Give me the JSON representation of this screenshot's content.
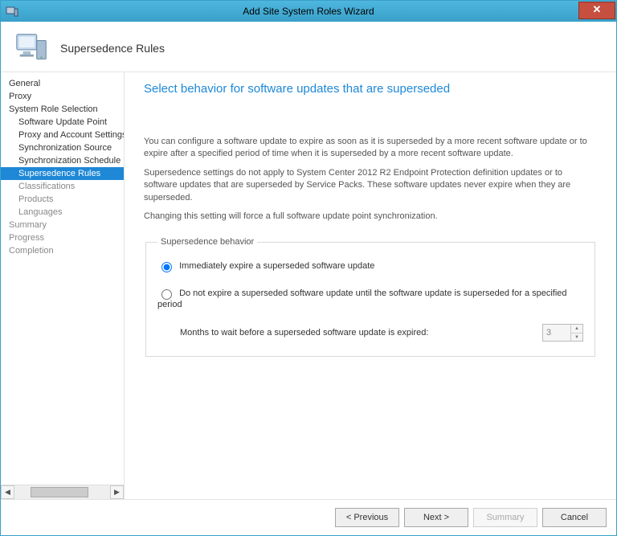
{
  "window": {
    "title": "Add Site System Roles Wizard"
  },
  "header": {
    "page_label": "Supersedence Rules"
  },
  "nav": {
    "items": [
      {
        "label": "General",
        "level": 0,
        "state": "past"
      },
      {
        "label": "Proxy",
        "level": 0,
        "state": "past"
      },
      {
        "label": "System Role Selection",
        "level": 0,
        "state": "past"
      },
      {
        "label": "Software Update Point",
        "level": 1,
        "state": "past"
      },
      {
        "label": "Proxy and Account Settings",
        "level": 1,
        "state": "past"
      },
      {
        "label": "Synchronization Source",
        "level": 1,
        "state": "past"
      },
      {
        "label": "Synchronization Schedule",
        "level": 1,
        "state": "past"
      },
      {
        "label": "Supersedence Rules",
        "level": 1,
        "state": "selected"
      },
      {
        "label": "Classifications",
        "level": 1,
        "state": "future"
      },
      {
        "label": "Products",
        "level": 1,
        "state": "future"
      },
      {
        "label": "Languages",
        "level": 1,
        "state": "future"
      },
      {
        "label": "Summary",
        "level": 0,
        "state": "future"
      },
      {
        "label": "Progress",
        "level": 0,
        "state": "future"
      },
      {
        "label": "Completion",
        "level": 0,
        "state": "future"
      }
    ]
  },
  "main": {
    "title": "Select behavior for software updates that are superseded",
    "para1": "You can configure a software update to expire as soon as it is superseded by a more recent software update or to expire after a specified period of time when it is superseded by a more recent software update.",
    "para2": "Supersedence settings do not apply to System Center 2012 R2 Endpoint Protection definition updates or to software updates that are superseded by Service Packs. These software updates never expire when they are superseded.",
    "para3": "Changing this setting will force a full software update point synchronization.",
    "group_legend": "Supersedence behavior",
    "radio1_label": "Immediately expire a superseded software update",
    "radio2_label": "Do not expire a superseded software update until the software update is superseded for a specified period",
    "months_label": "Months to wait before a superseded software update is expired:",
    "months_value": "3"
  },
  "footer": {
    "previous": "< Previous",
    "next": "Next >",
    "summary": "Summary",
    "cancel": "Cancel"
  }
}
